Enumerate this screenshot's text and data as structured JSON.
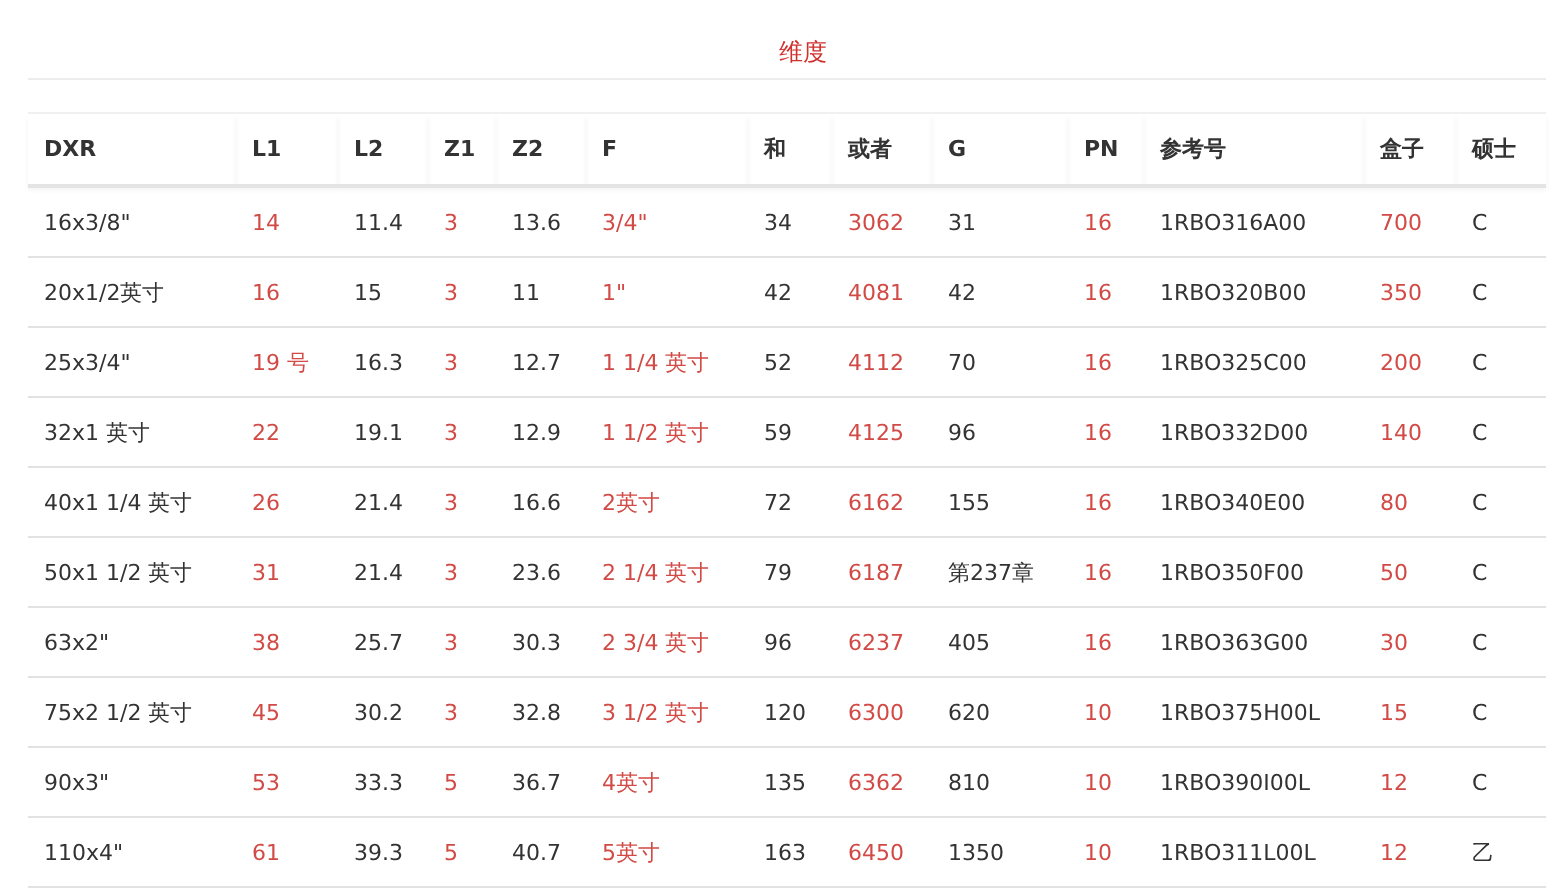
{
  "title": "维度",
  "table": {
    "columns": [
      {
        "label": "DXR",
        "accent": false
      },
      {
        "label": "L1",
        "accent": true
      },
      {
        "label": "L2",
        "accent": false
      },
      {
        "label": "Z1",
        "accent": true
      },
      {
        "label": "Z2",
        "accent": false
      },
      {
        "label": "F",
        "accent": true
      },
      {
        "label": "和",
        "accent": false
      },
      {
        "label": "或者",
        "accent": true
      },
      {
        "label": "G",
        "accent": false
      },
      {
        "label": "PN",
        "accent": true
      },
      {
        "label": "参考号",
        "accent": false
      },
      {
        "label": "盒子",
        "accent": true
      },
      {
        "label": "硕士",
        "accent": false
      }
    ],
    "rows": [
      [
        "16x3/8\"",
        "14",
        "11.4",
        "3",
        "13.6",
        "3/4\"",
        "34",
        "3062",
        "31",
        "16",
        "1RBO316A00",
        "700",
        "C"
      ],
      [
        "20x1/2英寸",
        "16",
        "15",
        "3",
        "11",
        "1\"",
        "42",
        "4081",
        "42",
        "16",
        "1RBO320B00",
        "350",
        "C"
      ],
      [
        "25x3/4\"",
        "19 号",
        "16.3",
        "3",
        "12.7",
        "1 1/4 英寸",
        "52",
        "4112",
        "70",
        "16",
        "1RBO325C00",
        "200",
        "C"
      ],
      [
        "32x1 英寸",
        "22",
        "19.1",
        "3",
        "12.9",
        "1 1/2 英寸",
        "59",
        "4125",
        "96",
        "16",
        "1RBO332D00",
        "140",
        "C"
      ],
      [
        "40x1 1/4 英寸",
        "26",
        "21.4",
        "3",
        "16.6",
        "2英寸",
        "72",
        "6162",
        "155",
        "16",
        "1RBO340E00",
        "80",
        "C"
      ],
      [
        "50x1 1/2 英寸",
        "31",
        "21.4",
        "3",
        "23.6",
        "2 1/4 英寸",
        "79",
        "6187",
        "第237章",
        "16",
        "1RBO350F00",
        "50",
        "C"
      ],
      [
        "63x2\"",
        "38",
        "25.7",
        "3",
        "30.3",
        "2 3/4 英寸",
        "96",
        "6237",
        "405",
        "16",
        "1RBO363G00",
        "30",
        "C"
      ],
      [
        "75x2 1/2 英寸",
        "45",
        "30.2",
        "3",
        "32.8",
        "3 1/2 英寸",
        "120",
        "6300",
        "620",
        "10",
        "1RBO375H00L",
        "15",
        "C"
      ],
      [
        "90x3\"",
        "53",
        "33.3",
        "5",
        "36.7",
        "4英寸",
        "135",
        "6362",
        "810",
        "10",
        "1RBO390I00L",
        "12",
        "C"
      ],
      [
        "110x4\"",
        "61",
        "39.3",
        "5",
        "40.7",
        "5英寸",
        "163",
        "6450",
        "1350",
        "10",
        "1RBO311L00L",
        "12",
        "乙"
      ]
    ]
  }
}
